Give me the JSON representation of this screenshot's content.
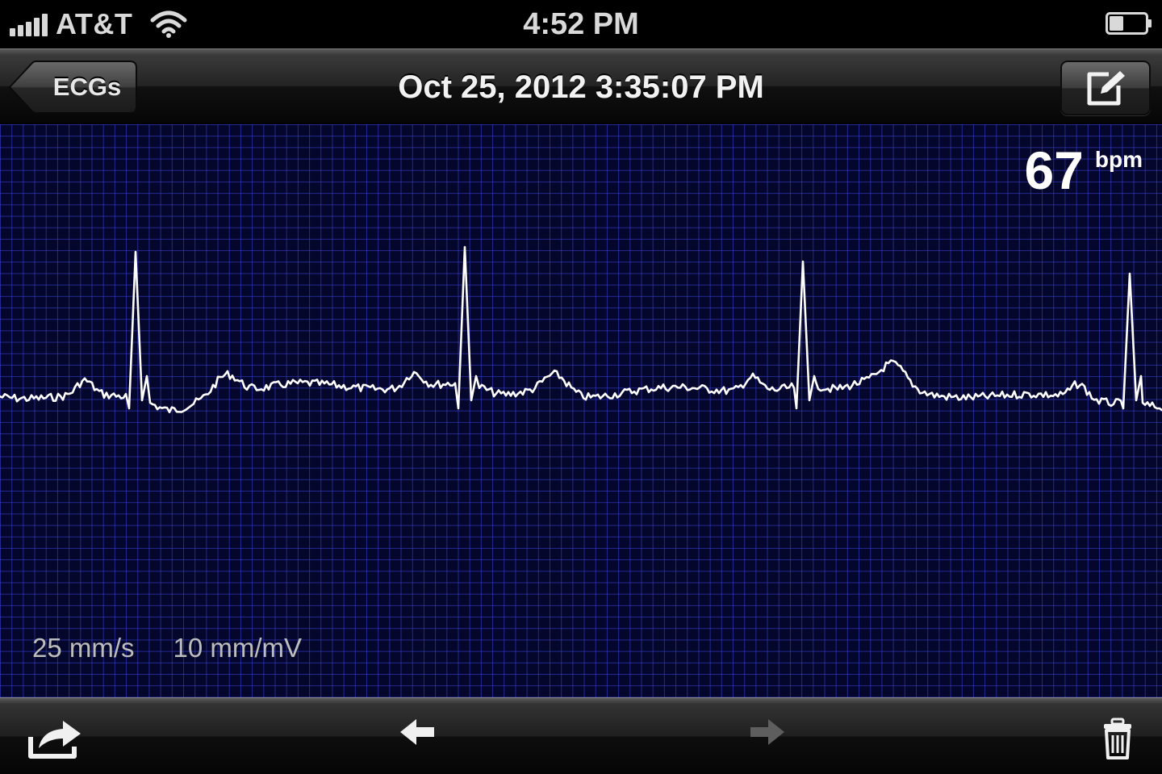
{
  "status_bar": {
    "carrier": "AT&T",
    "time": "4:52 PM",
    "icons": [
      "signal-bars-icon",
      "wifi-icon",
      "battery-icon"
    ]
  },
  "nav_bar": {
    "back_label": "ECGs",
    "title": "Oct 25, 2012 3:35:07 PM",
    "right_button_icon": "compose-icon"
  },
  "ecg": {
    "heart_rate_value": "67",
    "heart_rate_unit": "bpm",
    "paper_speed": "25 mm/s",
    "gain": "10 mm/mV",
    "grid_color": "#3c46e6",
    "background_color": "#05062b",
    "trace_color": "#ffffff"
  },
  "toolbar": {
    "icons": [
      "share-icon",
      "previous-arrow-icon",
      "next-arrow-icon",
      "trash-icon"
    ],
    "next_enabled": false
  }
}
